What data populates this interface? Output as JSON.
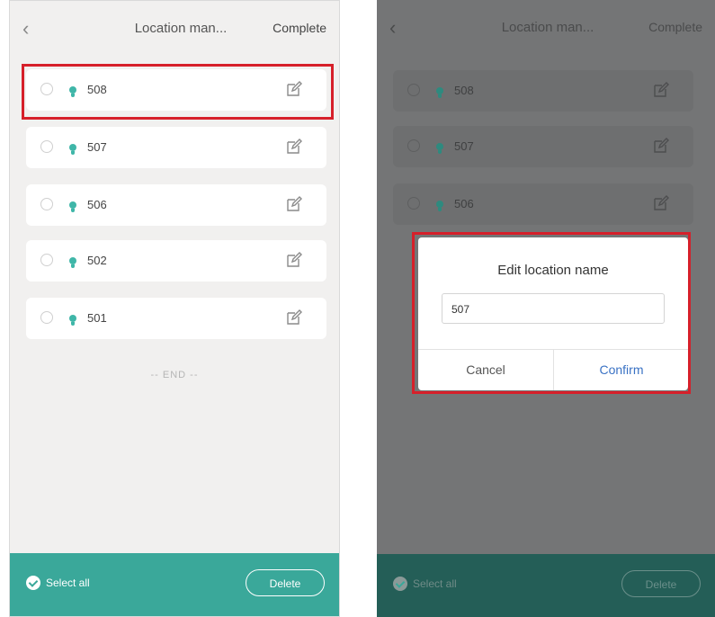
{
  "left": {
    "header": {
      "back_glyph": "‹",
      "title": "Location man...",
      "complete": "Complete"
    },
    "rows": [
      {
        "label": "508"
      },
      {
        "label": "507"
      },
      {
        "label": "506"
      },
      {
        "label": "502"
      },
      {
        "label": "501"
      }
    ],
    "end_text": "-- END --",
    "footer": {
      "select_all": "Select all",
      "delete": "Delete"
    }
  },
  "right": {
    "header": {
      "back_glyph": "‹",
      "title": "Location man...",
      "complete": "Complete"
    },
    "rows": [
      {
        "label": "508"
      },
      {
        "label": "507"
      },
      {
        "label": "506"
      }
    ],
    "dialog": {
      "title": "Edit location name",
      "input_value": "507",
      "cancel": "Cancel",
      "confirm": "Confirm"
    },
    "footer": {
      "select_all": "Select all",
      "delete": "Delete"
    }
  },
  "colors": {
    "accent": "#3aa89a",
    "highlight": "#d6202a",
    "confirm_text": "#3a72c4"
  },
  "icons": {
    "back": "chevron-left-icon",
    "location": "location-pin-icon",
    "edit": "edit-icon",
    "check": "check-circle-icon"
  }
}
